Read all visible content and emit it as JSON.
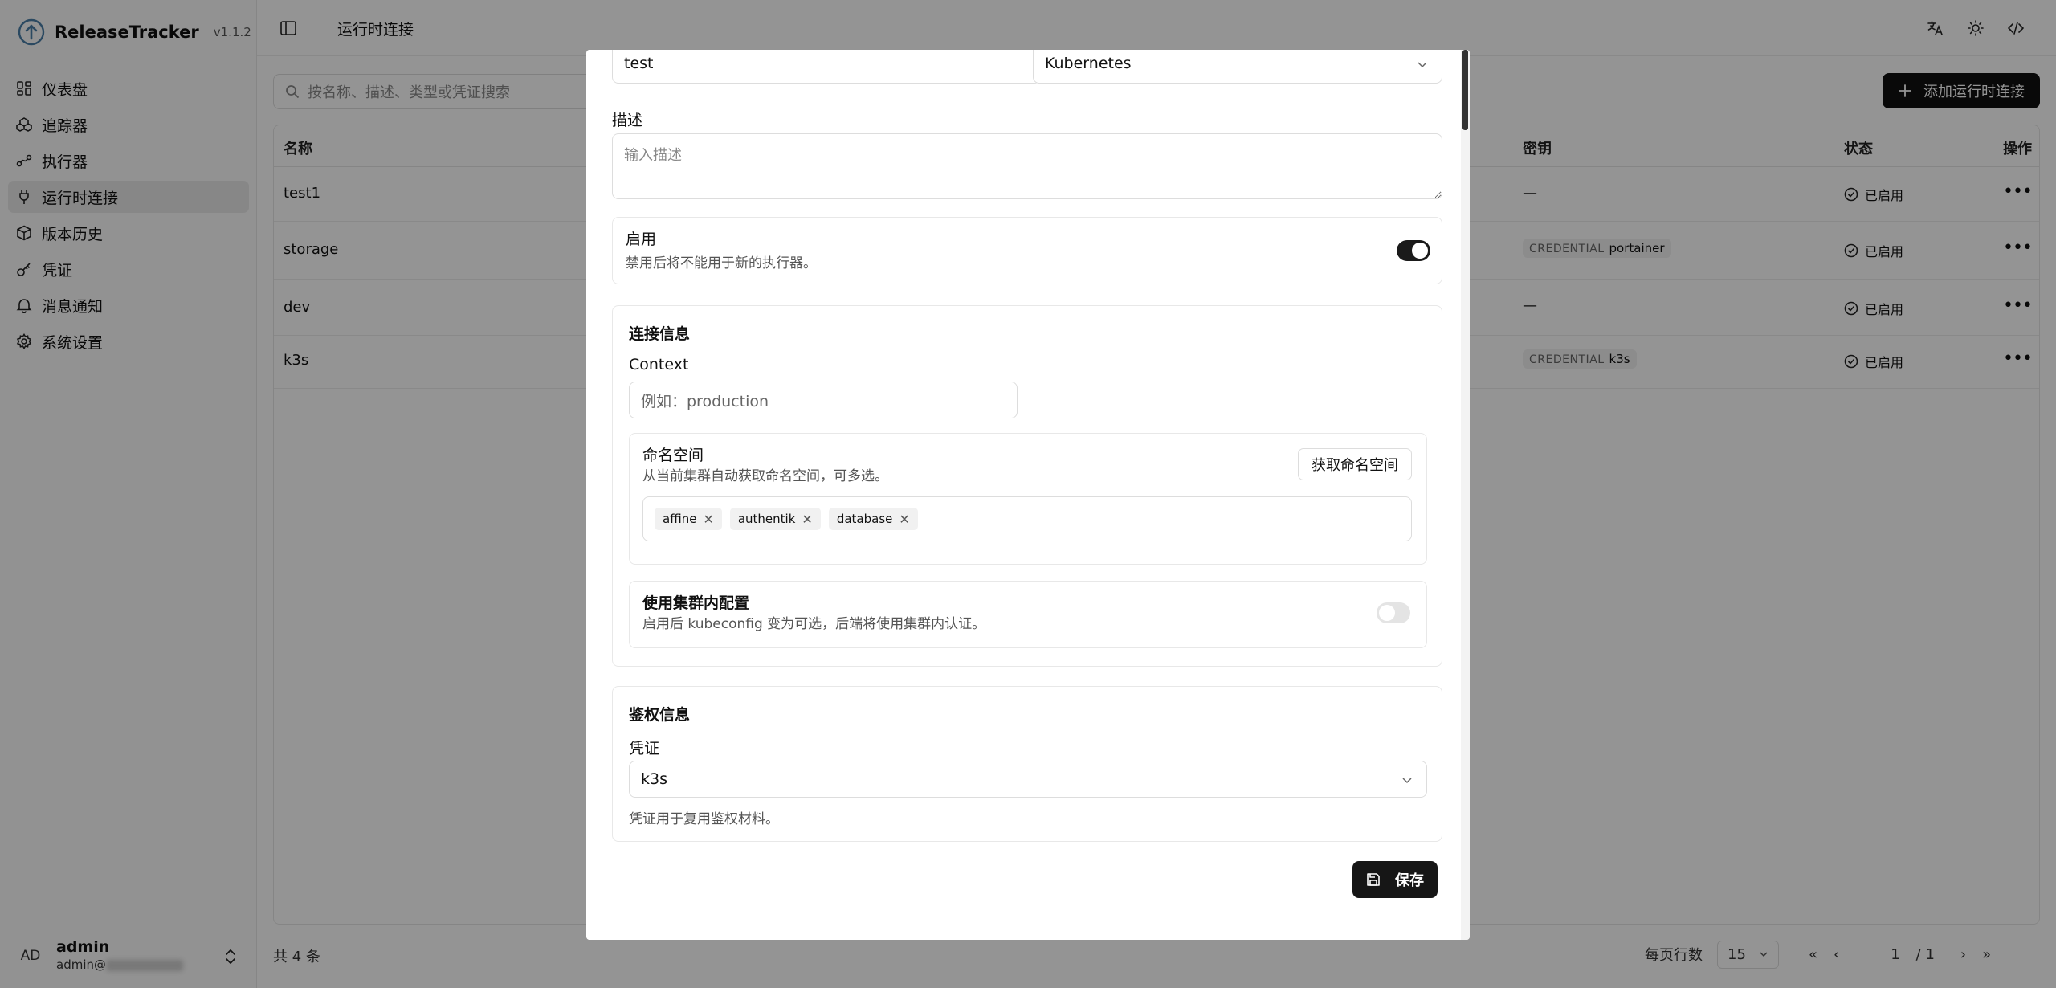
{
  "app": {
    "name": "ReleaseTracker",
    "version": "v1.1.2"
  },
  "sidebar": {
    "items": [
      {
        "label": "仪表盘",
        "icon": "dashboard-icon"
      },
      {
        "label": "追踪器",
        "icon": "tracker-icon"
      },
      {
        "label": "执行器",
        "icon": "executor-icon"
      },
      {
        "label": "运行时连接",
        "icon": "plug-icon"
      },
      {
        "label": "版本历史",
        "icon": "package-icon"
      },
      {
        "label": "凭证",
        "icon": "key-icon"
      },
      {
        "label": "消息通知",
        "icon": "bell-icon"
      },
      {
        "label": "系统设置",
        "icon": "gear-icon"
      }
    ],
    "active_index": 3
  },
  "user": {
    "initials": "AD",
    "name": "admin",
    "email_prefix": "admin@"
  },
  "header": {
    "title": "运行时连接"
  },
  "search": {
    "placeholder": "按名称、描述、类型或凭证搜索"
  },
  "add_button": {
    "label": "添加运行时连接"
  },
  "table": {
    "columns": {
      "name": "名称",
      "secret": "密钥",
      "status": "状态",
      "actions": "操作"
    },
    "rows": [
      {
        "name": "test1",
        "secret": "—",
        "credential": "",
        "status": "已启用"
      },
      {
        "name": "storage",
        "secret": "",
        "credential_tag": "CREDENTIAL",
        "credential": "portainer",
        "status": "已启用"
      },
      {
        "name": "dev",
        "secret": "—",
        "credential": "",
        "status": "已启用"
      },
      {
        "name": "k3s",
        "secret": "",
        "credential_tag": "CREDENTIAL",
        "credential": "k3s",
        "status": "已启用"
      }
    ]
  },
  "footer": {
    "count": "共 4 条",
    "rows_per_page_label": "每页行数",
    "rows_per_page": "15",
    "page": "1",
    "total_pages": "/ 1"
  },
  "modal": {
    "name_value": "test",
    "type_value": "Kubernetes",
    "description_label": "描述",
    "description_placeholder": "输入描述",
    "enabled_label": "启用",
    "enabled_help": "禁用后将不能用于新的执行器。",
    "enabled": true,
    "connection_title": "连接信息",
    "context_label": "Context",
    "context_placeholder": "例如：production",
    "namespace_label": "命名空间",
    "namespace_help": "从当前集群自动获取命名空间，可多选。",
    "fetch_namespaces_label": "获取命名空间",
    "namespaces": [
      "affine",
      "authentik",
      "database"
    ],
    "in_cluster_label": "使用集群内配置",
    "in_cluster_help": "启用后 kubeconfig 变为可选，后端将使用集群内认证。",
    "in_cluster": false,
    "auth_title": "鉴权信息",
    "credential_label": "凭证",
    "credential_value": "k3s",
    "credential_help": "凭证用于复用鉴权材料。",
    "save_label": "保存"
  }
}
